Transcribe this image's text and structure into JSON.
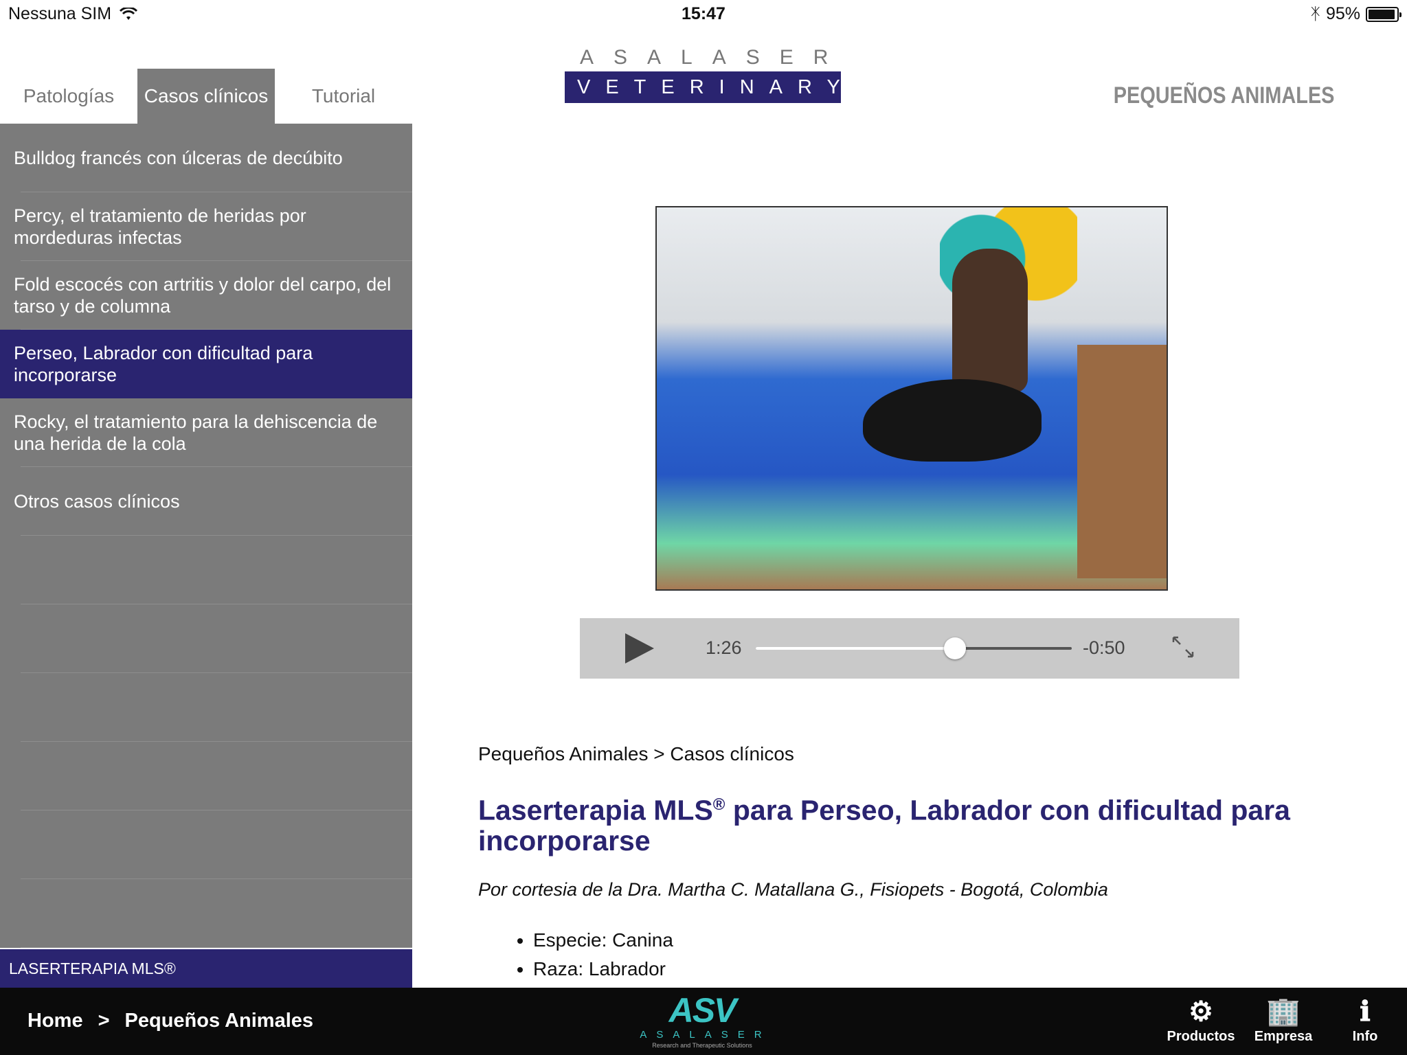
{
  "status": {
    "carrier": "Nessuna SIM",
    "time": "15:47",
    "battery_text": "95%",
    "battery_level": 0.95
  },
  "tabs": [
    {
      "label": "Patologías",
      "active": false
    },
    {
      "label": "Casos clínicos",
      "active": true
    },
    {
      "label": "Tutorial",
      "active": false
    }
  ],
  "logo": {
    "top": "ASALASER",
    "bottom": "VETERINARY"
  },
  "section_title": "PEQUEÑOS ANIMALES",
  "sidebar": {
    "items": [
      {
        "label": "Bulldog francés con úlceras de decúbito",
        "selected": false
      },
      {
        "label": "Percy, el tratamiento de heridas por mordeduras infectas",
        "selected": false
      },
      {
        "label": "Fold escocés con artritis y dolor del carpo, del tarso y de columna",
        "selected": false
      },
      {
        "label": "Perseo, Labrador con dificultad para incorporarse",
        "selected": true
      },
      {
        "label": "Rocky, el tratamiento para la dehiscencia de una herida de la cola",
        "selected": false
      },
      {
        "label": "Otros casos clínicos",
        "selected": false
      }
    ],
    "footer": "LASERTERAPIA MLS®"
  },
  "video": {
    "elapsed": "1:26",
    "remaining": "-0:50",
    "progress": 0.63
  },
  "article": {
    "breadcrumb": "Pequeños Animales > Casos clínicos",
    "title_part1": "Laserterapia MLS",
    "title_reg": "®",
    "title_part2": " para Perseo, Labrador con dificultad para incorporarse",
    "credit": "Por cortesia de la Dra. Martha C. Matallana G., Fisiopets - Bogotá, Colombia",
    "details": [
      "Especie: Canina",
      "Raza: Labrador"
    ]
  },
  "bottombar": {
    "crumb_home": "Home",
    "crumb_sep": ">",
    "crumb_current": "Pequeños Animales",
    "logo_mark": "ASV",
    "logo_word": "ASALASER",
    "logo_tag": "Research and Therapeutic Solutions",
    "nav": [
      {
        "label": "Productos",
        "icon": "gears-icon"
      },
      {
        "label": "Empresa",
        "icon": "building-icon"
      },
      {
        "label": "Info",
        "icon": "info-icon"
      }
    ]
  }
}
